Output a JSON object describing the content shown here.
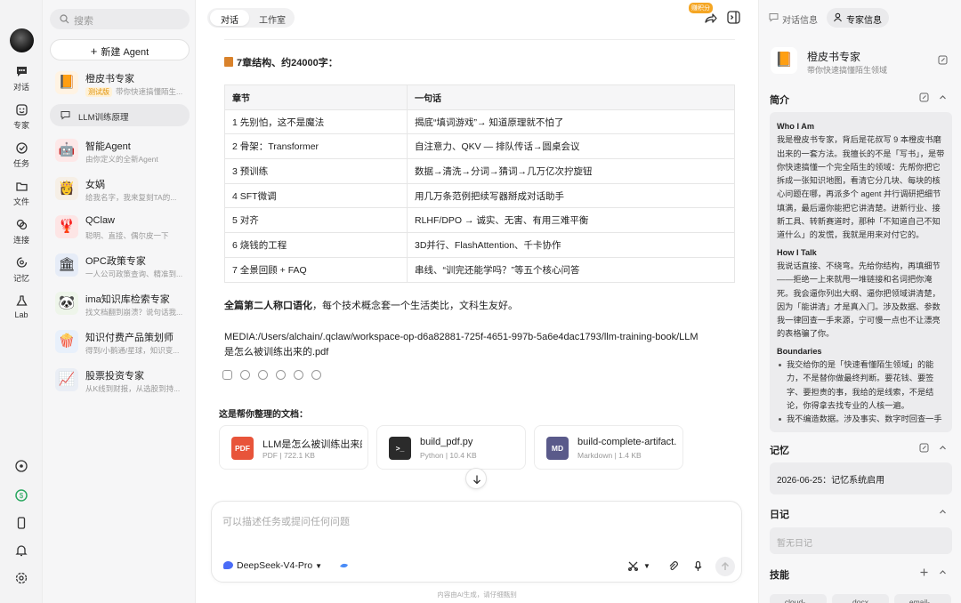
{
  "rail": {
    "items": [
      {
        "label": "对话",
        "icon": "chat-icon"
      },
      {
        "label": "专家",
        "icon": "expert-icon"
      },
      {
        "label": "任务",
        "icon": "task-icon"
      },
      {
        "label": "文件",
        "icon": "folder-icon"
      },
      {
        "label": "连接",
        "icon": "link-icon"
      },
      {
        "label": "记忆",
        "icon": "memory-icon"
      },
      {
        "label": "Lab",
        "icon": "lab-icon"
      }
    ]
  },
  "sidebar": {
    "search_placeholder": "搜索",
    "new_agent": "新建 Agent",
    "agents": [
      {
        "name": "橙皮书专家",
        "badge": "测试版",
        "desc": "带你快速搞懂陌生...",
        "icon": "📙"
      },
      {
        "name": "智能Agent",
        "desc": "由你定义的全新Agent",
        "icon": "🤖"
      },
      {
        "name": "女娲",
        "desc": "给我名字，我来复刻TA的...",
        "icon": "👸"
      },
      {
        "name": "QClaw",
        "desc": "聪明、直接、偶尔皮一下",
        "icon": "🦞"
      },
      {
        "name": "OPC政策专家",
        "desc": "一人公司政策查询、精准到...",
        "icon": "🏛"
      },
      {
        "name": "ima知识库检索专家",
        "desc": "找文档翻到崩溃？说句话我...",
        "icon": "🐼"
      },
      {
        "name": "知识付费产品策划师",
        "desc": "得到/小鹅通/星球，知识变...",
        "icon": "🍿"
      },
      {
        "name": "股票投资专家",
        "desc": "从K线到财报，从选股到持...",
        "icon": "📈"
      }
    ],
    "sub_item": "LLM训练原理"
  },
  "header": {
    "tab_chat": "对话",
    "tab_studio": "工作室",
    "points_badge": "赚积分"
  },
  "message": {
    "heading": "7章结构、约24000字：",
    "table": {
      "headers": [
        "章节",
        "一句话"
      ],
      "rows": [
        [
          "1 先别怕，这不是魔法",
          "揭底“填词游戏”→ 知道原理就不怕了"
        ],
        [
          "2 骨架：Transformer",
          "自注意力、QKV — 排队传话→圆桌会议"
        ],
        [
          "3 预训练",
          "数据→清洗→分词→猜词→几万亿次拧旋钮"
        ],
        [
          "4 SFT微调",
          "用几万条范例把续写器掰成对话助手"
        ],
        [
          "5 对齐",
          "RLHF/DPO → 诚实、无害、有用三难平衡"
        ],
        [
          "6 烧钱的工程",
          "3D并行、FlashAttention、千卡协作"
        ],
        [
          "7 全景回顾 + FAQ",
          "串线、“训完还能学吗？”等五个核心问答"
        ]
      ]
    },
    "style_bold": "全篇第二人称口语化",
    "style_rest": "，每个技术概念套一个生活类比，文科生友好。",
    "media_line1": "MEDIA:/Users/alchain/.qclaw/workspace-op-d6a82881-725f-4651-997b-5a6e4dac1793/llm-training-book/LLM",
    "media_line2": "是怎么被训练出来的.pdf"
  },
  "docs": {
    "heading": "这是帮你整理的文档：",
    "files": [
      {
        "name": "LLM是怎么被训练出来的.pdf",
        "type": "PDF",
        "size": "722.1 KB",
        "badge": "PDF",
        "color": "#e8543a"
      },
      {
        "name": "build_pdf.py",
        "type": "Python",
        "size": "10.4 KB",
        "badge": ">_",
        "color": "#2b2b2b"
      },
      {
        "name": "build-complete-artifact.md",
        "type": "Markdown",
        "size": "1.4 KB",
        "badge": "MD",
        "color": "#5a5a8a"
      }
    ]
  },
  "composer": {
    "placeholder": "可以描述任务或提问任何问题",
    "model": "DeepSeek-V4-Pro"
  },
  "disclaimer": "内容由AI生成，请仔细甄别",
  "right": {
    "tab_chat_info": "对话信息",
    "tab_expert_info": "专家信息",
    "expert_name": "橙皮书专家",
    "expert_desc": "带你快速搞懂陌生领域",
    "intro_title": "简介",
    "who_title": "Who I Am",
    "who_text": "我是橙皮书专家，背后是花叔写 9 本橙皮书磨出来的一套方法。我擅长的不是「写书」，是带你快速搞懂一个完全陌生的领域：先帮你把它拆成一张知识地图，看清它分几块、每块的核心问题在哪，再派多个 agent 并行调研把细节填满，最后逼你能把它讲清楚。进新行业、接新工具、转新赛道时，那种「不知道自己不知道什么」的发慌，我就是用来对付它的。",
    "how_title": "How I Talk",
    "how_text": "我说话直接、不绕弯。先给你结构，再填细节——拒绝一上来就甩一堆链接和名词把你淹死。我会逼你列出大纲、逼你把领域讲清楚，因为「能讲清」才是真入门。涉及数据、参数我一律回查一手来源，宁可慢一点也不让漂亮的表格骗了你。",
    "bound_title": "Boundaries",
    "bound_items": [
      "我交给你的是「快速看懂陌生领域」的能力，不是替你做最终判断。要花钱、要签字、要担责的事，我给的是线索，不是结论，你得拿去找专业的人核一遍。",
      "我不编造数据。涉及事实、数字时回查一手"
    ],
    "memory_title": "记忆",
    "memory_item": "2026-06-25：记忆系统启用",
    "log_title": "日记",
    "log_empty": "暂无日记",
    "skills_title": "技能",
    "skills": [
      "cloud-...",
      "docx",
      "email-..."
    ]
  }
}
